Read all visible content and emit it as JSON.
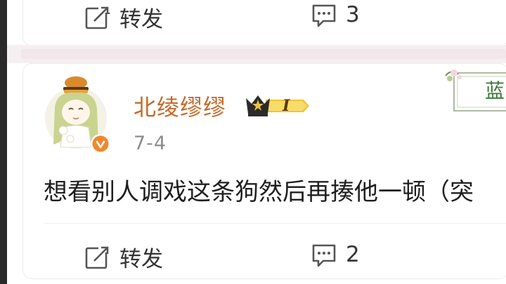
{
  "top_post": {
    "repost_label": "转发",
    "comment_count": "3"
  },
  "comment": {
    "username": "北绫缪缪",
    "level_badge": "I",
    "timestamp": "7-4",
    "text": "想看别人调戏这条狗然后再揍他一顿（突",
    "repost_label": "转发",
    "comment_count": "2"
  },
  "stamp_text": "蓝",
  "colors": {
    "username": "#c46a2a",
    "text": "#1f1f1f",
    "muted": "#8c8c8c",
    "separator": "#f6eff2",
    "badge_gold": "#f0c43a"
  },
  "icons": [
    "repost-icon",
    "comment-icon",
    "crown-icon",
    "verified-icon"
  ]
}
